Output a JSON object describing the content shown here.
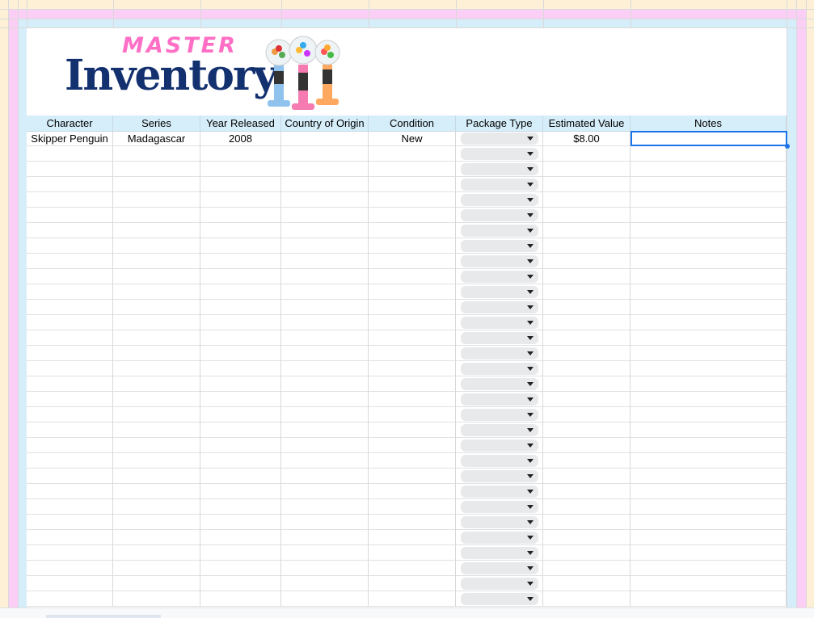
{
  "logo": {
    "master": "MASTER",
    "inventory": "Inventory"
  },
  "columns": [
    "Character",
    "Series",
    "Year Released",
    "Country of Origin",
    "Condition",
    "Package Type",
    "Estimated Value",
    "Notes"
  ],
  "rows": [
    {
      "character": "Skipper Penguin",
      "series": "Madagascar",
      "year": "2008",
      "country": "",
      "condition": "New",
      "package": "",
      "value": "$8.00",
      "notes": ""
    }
  ],
  "colors": {
    "cream": "#fdf0d7",
    "pink": "#fbcff5",
    "blue": "#d6eefa",
    "navy": "#13306f",
    "hot_pink": "#ff6fc5",
    "selection": "#1a73e8"
  }
}
